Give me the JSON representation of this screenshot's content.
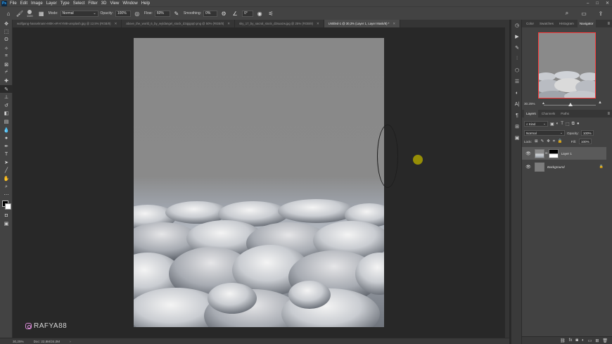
{
  "menubar": {
    "logo": "Ps",
    "items": [
      "File",
      "Edit",
      "Image",
      "Layer",
      "Type",
      "Select",
      "Filter",
      "3D",
      "View",
      "Window",
      "Help"
    ]
  },
  "options": {
    "brush_size": "1100",
    "mode_label": "Mode:",
    "mode_value": "Normal",
    "opacity_label": "Opacity:",
    "opacity_value": "100%",
    "flow_label": "Flow:",
    "flow_value": "60%",
    "smoothing_label": "Smoothing:",
    "smoothing_value": "0%",
    "angle_value": "0°"
  },
  "tabs": [
    {
      "label": "wolfgang-hasselmann-M0K-eR-KYM8-unsplash.jpg @ 12,5% (RGB/8)"
    },
    {
      "label": "above_the_world_6_by_wyldangel_stock_d2qjqpq0.png @ 50% (RGB/8)"
    },
    {
      "label": "sky_17_by_sacral_stock_d2suazw.jpg @ 25% (RGB/8)"
    },
    {
      "label": "Untitled-1 @ 30,3% (Layer 1, Layer Mask/8) *"
    }
  ],
  "watermark": "RAFYA88",
  "status": {
    "zoom": "30,25%",
    "doc": "Doc: 22,8M/24,0M"
  },
  "panel_top": {
    "tabs": [
      "Color",
      "Swatches",
      "Histogram",
      "Navigator"
    ],
    "zoom": "30.25%"
  },
  "layers_panel": {
    "tabs": [
      "Layers",
      "Channels",
      "Paths"
    ],
    "filter_label": "Kind",
    "blend_mode": "Normal",
    "opacity_label": "Opacity:",
    "opacity_value": "100%",
    "lock_label": "Lock:",
    "fill_label": "Fill:",
    "fill_value": "100%",
    "layers": [
      {
        "name": "Layer 1"
      },
      {
        "name": "Background"
      }
    ]
  },
  "colors": {
    "accent_red": "#ff3b3b",
    "brush_cursor": "#a9a000"
  }
}
